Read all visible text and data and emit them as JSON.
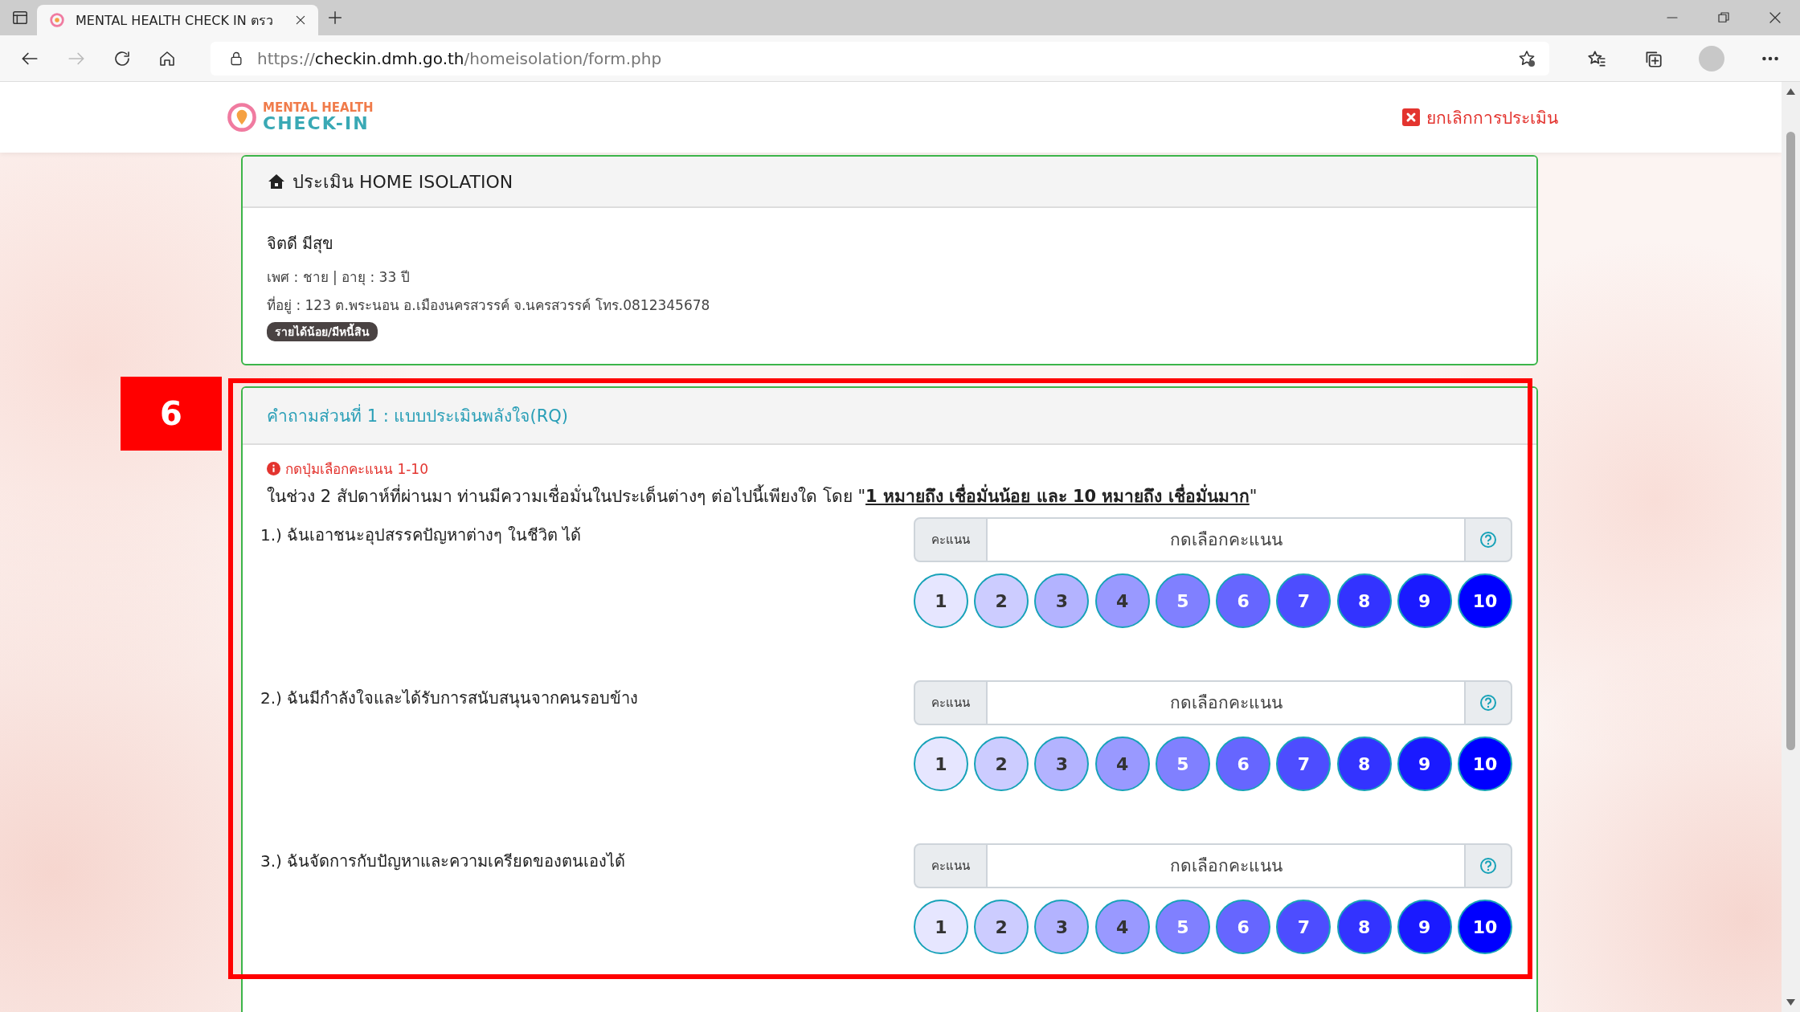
{
  "browser": {
    "tab_title": "MENTAL HEALTH CHECK IN ตรว",
    "url_scheme": "https://",
    "url_host": "checkin.dmh.go.th",
    "url_path": "/homeisolation/form.php"
  },
  "header": {
    "logo_line1": "MENTAL HEALTH",
    "logo_line2": "CHECK-IN",
    "cancel_link": "ยกเลิกการประเมิน"
  },
  "profile_card": {
    "title": "ประเมิน HOME ISOLATION",
    "name": "จิตดี มีสุข",
    "details": "เพศ : ชาย | อายุ : 33 ปี",
    "address": "ที่อยู่ : 123 ต.พระนอน อ.เมืองนครสวรรค์ จ.นครสวรรค์ โทร.0812345678",
    "tag": "รายได้น้อย/มีหนี้สิน"
  },
  "annotation": {
    "label": "6"
  },
  "section": {
    "title": "คำถามส่วนที่ 1 : แบบประเมินพลังใจ(RQ)",
    "hint": "กดปุ่มเลือกคะแนน 1-10",
    "instruction": "ในช่วง 2 สัปดาห์ที่ผ่านมา ท่านมีความเชื่อมั่นในประเด็นต่างๆ ต่อไปนี้เพียงใด โดย \"**1 หมายถึง เชื่อมั่นน้อย และ 10 หมายถึง เชื่อมั่นมาก**\"",
    "questions": [
      {
        "label": "1.) ฉันเอาชนะอุปสรรคปัญหาต่างๆ ในชีวิต ได้",
        "score_label": "คะแนน",
        "placeholder": "กดเลือกคะแนน",
        "options": [
          {
            "label": "1",
            "color": "#e6e6ff"
          },
          {
            "label": "2",
            "color": "#ccccff"
          },
          {
            "label": "3",
            "color": "#b3b3ff"
          },
          {
            "label": "4",
            "color": "#9999ff"
          },
          {
            "label": "5",
            "color": "#8080ff"
          },
          {
            "label": "6",
            "color": "#6666ff"
          },
          {
            "label": "7",
            "color": "#4d4dff"
          },
          {
            "label": "8",
            "color": "#3333ff"
          },
          {
            "label": "9",
            "color": "#1a1aff"
          },
          {
            "label": "10",
            "color": "#0000ff"
          }
        ]
      },
      {
        "label": "2.) ฉันมีกำลังใจและได้รับการสนับสนุนจากคนรอบข้าง",
        "score_label": "คะแนน",
        "placeholder": "กดเลือกคะแนน",
        "options": [
          {
            "label": "1",
            "color": "#e6e6ff"
          },
          {
            "label": "2",
            "color": "#ccccff"
          },
          {
            "label": "3",
            "color": "#b3b3ff"
          },
          {
            "label": "4",
            "color": "#9999ff"
          },
          {
            "label": "5",
            "color": "#8080ff"
          },
          {
            "label": "6",
            "color": "#6666ff"
          },
          {
            "label": "7",
            "color": "#4d4dff"
          },
          {
            "label": "8",
            "color": "#3333ff"
          },
          {
            "label": "9",
            "color": "#1a1aff"
          },
          {
            "label": "10",
            "color": "#0000ff"
          }
        ]
      },
      {
        "label": "3.) ฉันจัดการกับปัญหาและความเครียดของตนเองได้",
        "score_label": "คะแนน",
        "placeholder": "กดเลือกคะแนน",
        "options": [
          {
            "label": "1",
            "color": "#e6e6ff"
          },
          {
            "label": "2",
            "color": "#ccccff"
          },
          {
            "label": "3",
            "color": "#b3b3ff"
          },
          {
            "label": "4",
            "color": "#9999ff"
          },
          {
            "label": "5",
            "color": "#8080ff"
          },
          {
            "label": "6",
            "color": "#6666ff"
          },
          {
            "label": "7",
            "color": "#4d4dff"
          },
          {
            "label": "8",
            "color": "#3333ff"
          },
          {
            "label": "9",
            "color": "#1a1aff"
          },
          {
            "label": "10",
            "color": "#0000ff"
          }
        ]
      }
    ]
  }
}
